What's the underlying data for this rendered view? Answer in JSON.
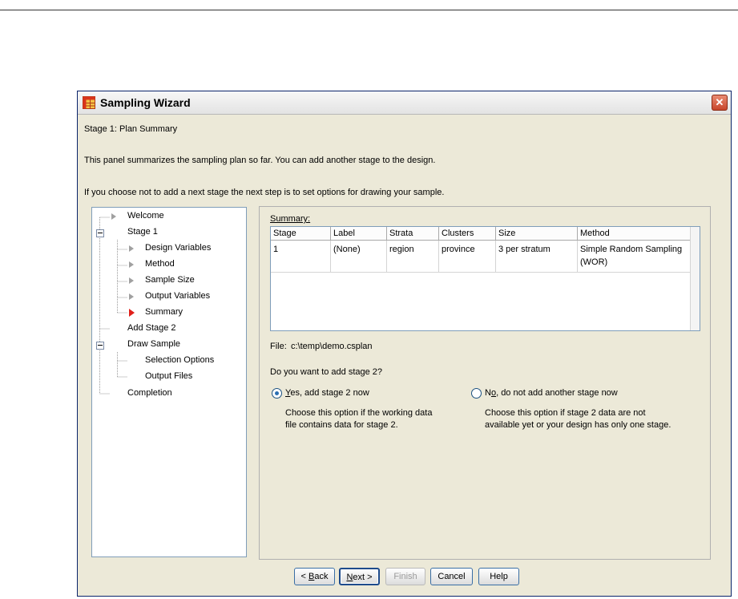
{
  "window": {
    "title": "Sampling Wizard",
    "icon": "grid-app-icon",
    "close_label": "✕"
  },
  "stage_heading": "Stage 1: Plan Summary",
  "description": {
    "line1": "This panel summarizes the sampling plan so far. You can add another stage to the design.",
    "line2": "If you choose not to add a next stage the next step is to set options for drawing your sample."
  },
  "nav_tree": {
    "items": [
      {
        "label": "Welcome"
      },
      {
        "label": "Stage 1"
      },
      {
        "label": "Design Variables"
      },
      {
        "label": "Method"
      },
      {
        "label": "Sample Size"
      },
      {
        "label": "Output Variables"
      },
      {
        "label": "Summary",
        "active": true
      },
      {
        "label": "Add Stage 2"
      },
      {
        "label": "Draw Sample"
      },
      {
        "label": "Selection Options"
      },
      {
        "label": "Output Files"
      },
      {
        "label": "Completion"
      }
    ]
  },
  "summary": {
    "label": "Summary:",
    "columns": [
      "Stage",
      "Label",
      "Strata",
      "Clusters",
      "Size",
      "Method"
    ],
    "rows": [
      {
        "stage": "1",
        "label": "(None)",
        "strata": "region",
        "clusters": "province",
        "size": "3 per stratum",
        "method_line1": "Simple Random Sampling",
        "method_line2": "(WOR)"
      }
    ]
  },
  "file": {
    "label": "File:",
    "path": "c:\\temp\\demo.csplan"
  },
  "question": "Do you want to add stage 2?",
  "options": {
    "yes": {
      "label_prefix": "Y",
      "label_rest": "es, add stage 2 now",
      "selected": true,
      "help_line1": "Choose this option if the working data",
      "help_line2": "file contains data for stage 2."
    },
    "no": {
      "label_prefix": "N",
      "label_mnemonic": "o",
      "label_rest": ", do not add another stage now",
      "selected": false,
      "help_line1": "Choose this option if stage 2 data are not",
      "help_line2": "available yet or your design has only one stage."
    }
  },
  "buttons": {
    "back": {
      "prefix": "< ",
      "mnemonic": "B",
      "rest": "ack"
    },
    "next": {
      "mnemonic": "N",
      "rest": "ext >"
    },
    "finish": "Finish",
    "cancel": "Cancel",
    "help": "Help"
  }
}
